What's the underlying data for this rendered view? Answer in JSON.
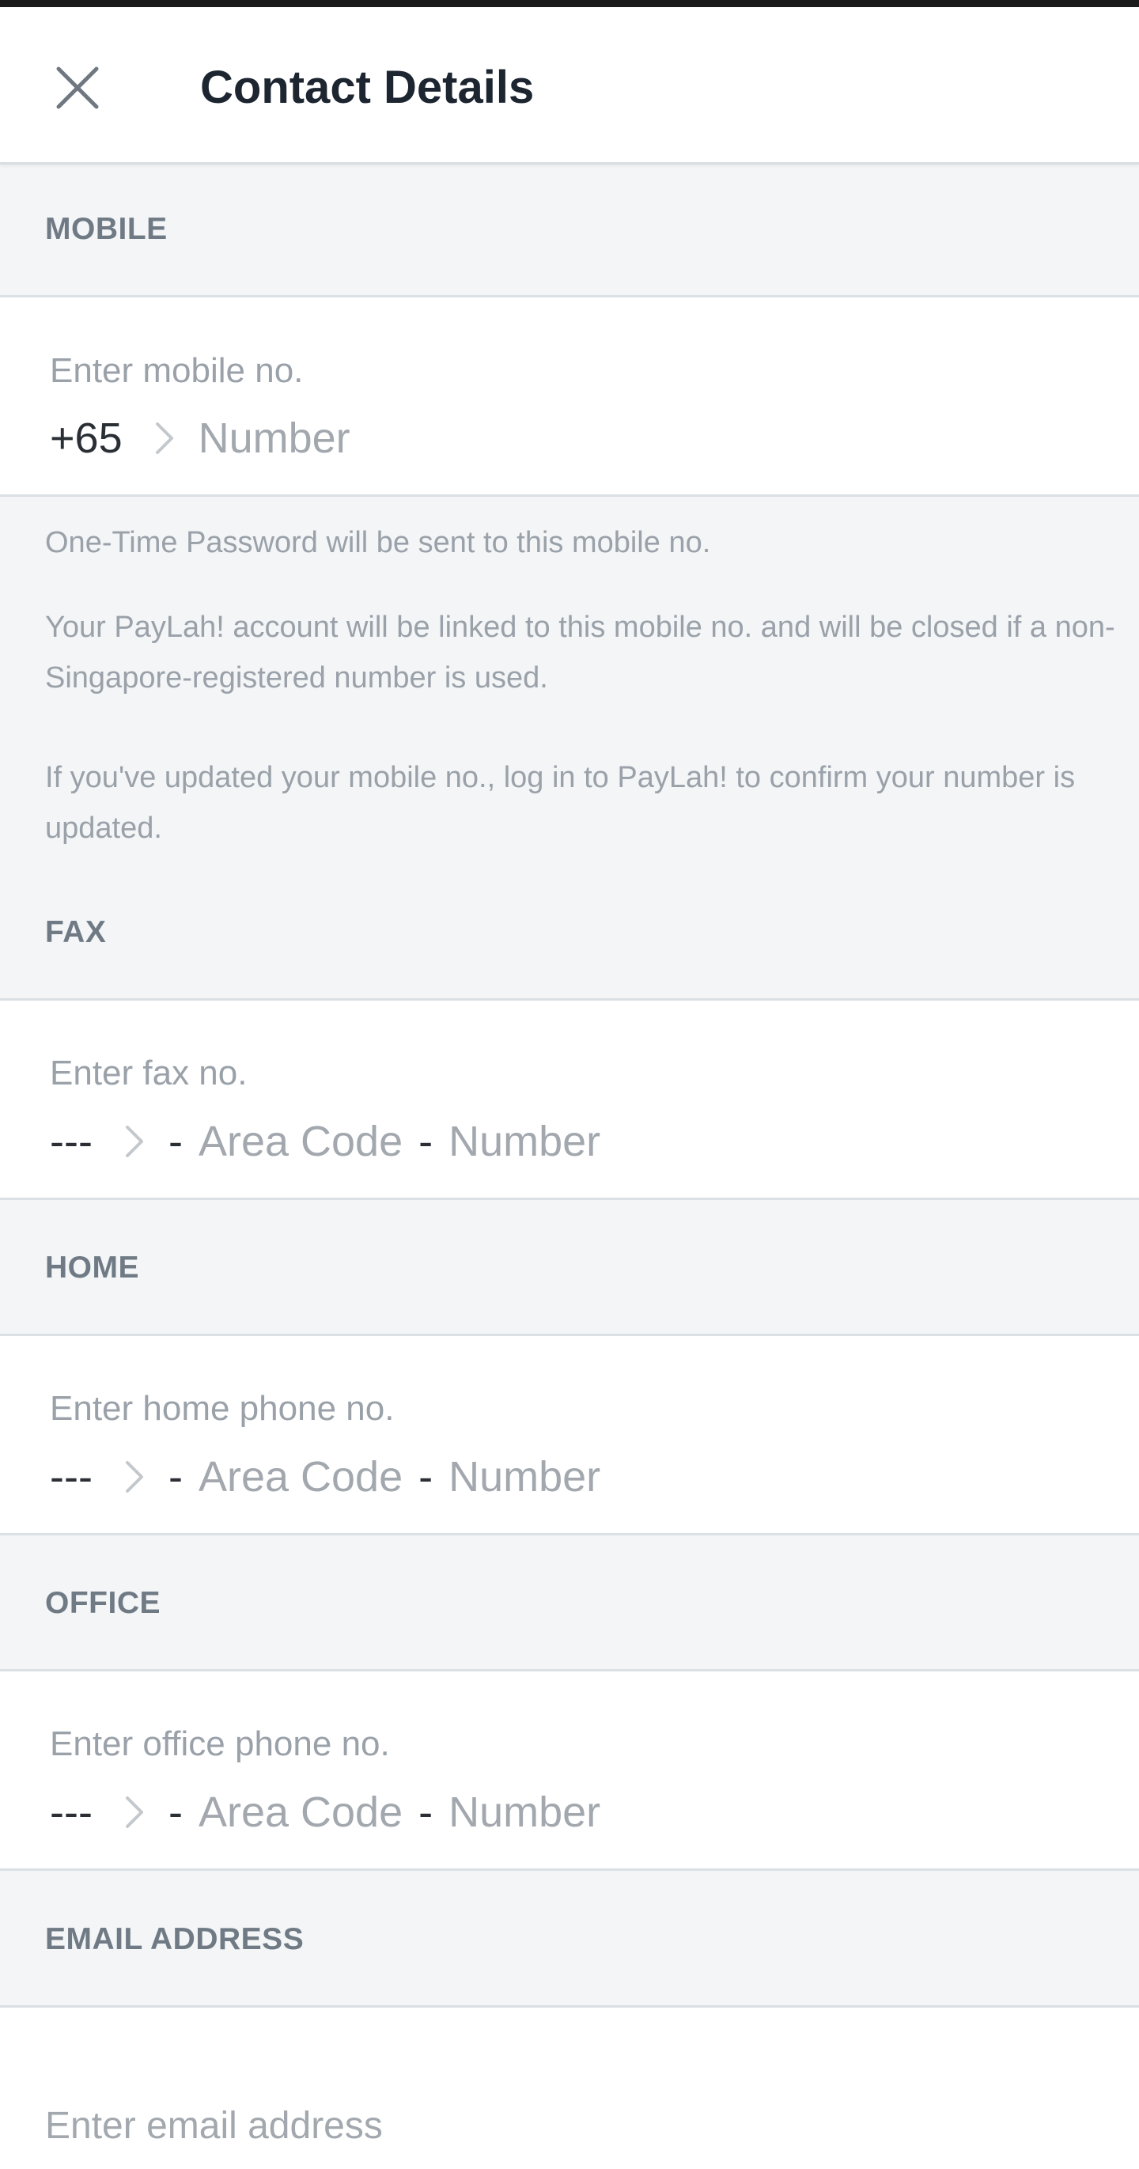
{
  "header": {
    "title": "Contact Details",
    "close_icon": "close-icon"
  },
  "mobile": {
    "section_label": "MOBILE",
    "field_label": "Enter mobile no.",
    "country_code": "+65",
    "number_placeholder": "Number",
    "notes": [
      "One-Time Password will be sent to this mobile no.",
      "Your PayLah! account will be linked to this mobile no. and will be closed if a non-Singapore-registered number is used.",
      "If you've updated your mobile no., log in to PayLah! to confirm your number is updated."
    ]
  },
  "fax": {
    "section_label": "FAX",
    "field_label": "Enter fax no.",
    "country_code": "---",
    "separator": "-",
    "area_code_placeholder": "Area Code",
    "number_placeholder": "Number"
  },
  "home": {
    "section_label": "HOME",
    "field_label": "Enter home phone no.",
    "country_code": "---",
    "separator": "-",
    "area_code_placeholder": "Area Code",
    "number_placeholder": "Number"
  },
  "office": {
    "section_label": "OFFICE",
    "field_label": "Enter office phone no.",
    "country_code": "---",
    "separator": "-",
    "area_code_placeholder": "Area Code",
    "number_placeholder": "Number"
  },
  "email": {
    "section_label": "EMAIL ADDRESS",
    "placeholder": "Enter email address"
  },
  "colors": {
    "background": "#f3f5f7",
    "card": "#ffffff",
    "title": "#1c2530",
    "section_label": "#6f7a85",
    "placeholder": "#a2a8ae"
  }
}
